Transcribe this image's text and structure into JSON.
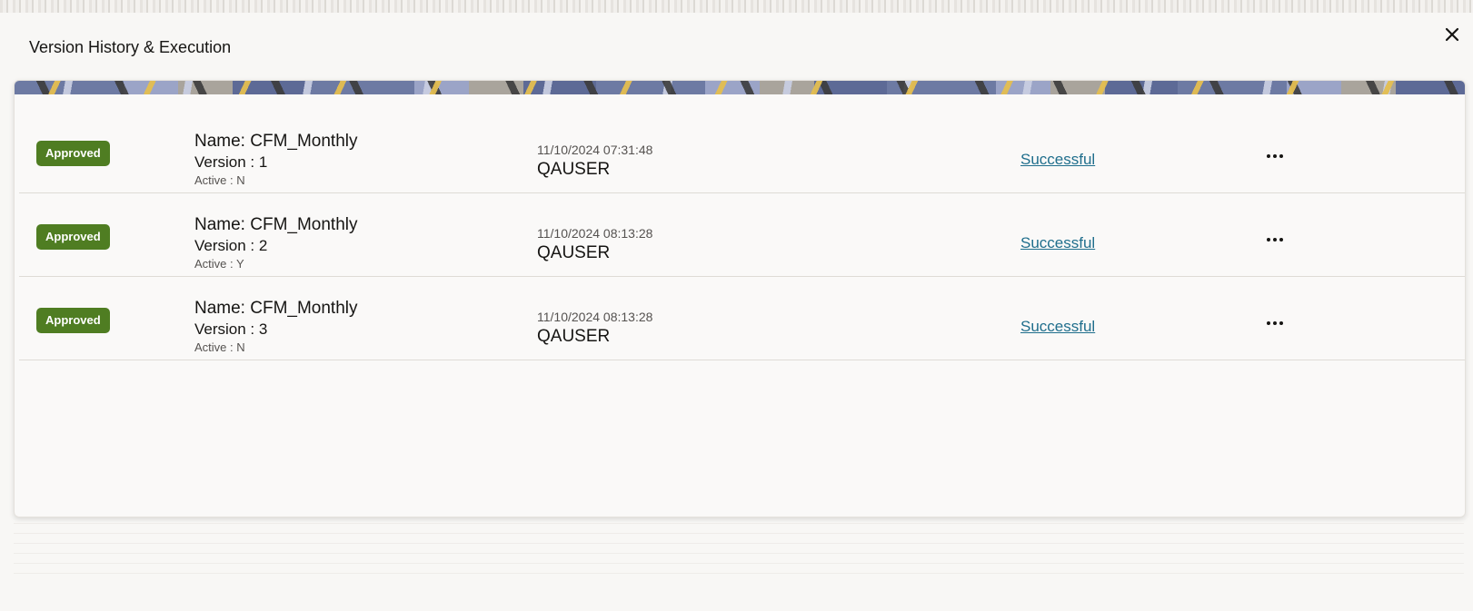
{
  "dialog": {
    "title": "Version History & Execution",
    "close_icon": "close-icon"
  },
  "rows": [
    {
      "status_badge": "Approved",
      "name": "Name: CFM_Monthly",
      "version": "Version : 1",
      "active": "Active : N",
      "timestamp": "11/10/2024 07:31:48",
      "user": "QAUSER",
      "execution_status": "Successful",
      "more_icon": "more-horizontal-icon"
    },
    {
      "status_badge": "Approved",
      "name": "Name: CFM_Monthly",
      "version": "Version : 2",
      "active": "Active : Y",
      "timestamp": "11/10/2024 08:13:28",
      "user": "QAUSER",
      "execution_status": "Successful",
      "more_icon": "more-horizontal-icon"
    },
    {
      "status_badge": "Approved",
      "name": "Name: CFM_Monthly",
      "version": "Version : 3",
      "active": "Active : N",
      "timestamp": "11/10/2024 08:13:28",
      "user": "QAUSER",
      "execution_status": "Successful",
      "more_icon": "more-horizontal-icon"
    }
  ],
  "colors": {
    "badge_approved": "#4f7d22",
    "link": "#1f6e8c",
    "background": "#f8f7f5"
  }
}
